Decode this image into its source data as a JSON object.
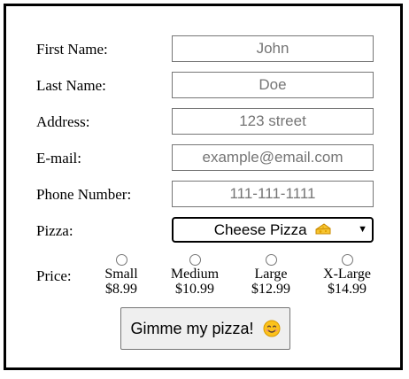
{
  "form": {
    "first_name": {
      "label": "First Name:",
      "placeholder": "John"
    },
    "last_name": {
      "label": "Last Name:",
      "placeholder": "Doe"
    },
    "address": {
      "label": "Address:",
      "placeholder": "123 street"
    },
    "email": {
      "label": "E-mail:",
      "placeholder": "example@email.com"
    },
    "phone": {
      "label": "Phone Number:",
      "placeholder": "111-111-1111"
    },
    "pizza": {
      "label": "Pizza:",
      "selected": "Cheese Pizza",
      "icon": "cheese-icon"
    },
    "price": {
      "label": "Price:",
      "options": [
        {
          "size": "Small",
          "price": "$8.99"
        },
        {
          "size": "Medium",
          "price": "$10.99"
        },
        {
          "size": "Large",
          "price": "$12.99"
        },
        {
          "size": "X-Large",
          "price": "$14.99"
        }
      ]
    },
    "submit": {
      "label": "Gimme my pizza!",
      "icon": "smiling-face-icon"
    }
  }
}
